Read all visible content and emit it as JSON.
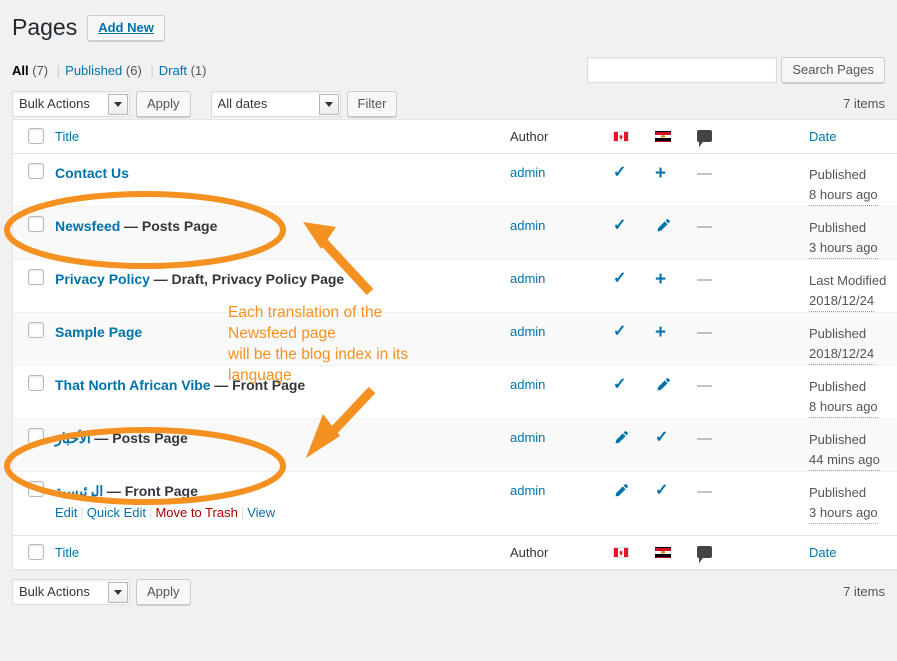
{
  "header": {
    "title": "Pages",
    "add_new_label": "Add New"
  },
  "status_filters": [
    {
      "label": "All",
      "count": "(7)",
      "current": true
    },
    {
      "label": "Published",
      "count": "(6)",
      "current": false
    },
    {
      "label": "Draft",
      "count": "(1)",
      "current": false
    }
  ],
  "search": {
    "value": "",
    "placeholder": "",
    "button_label": "Search Pages"
  },
  "tablenav": {
    "bulk_actions_label": "Bulk Actions",
    "apply_label": "Apply",
    "all_dates_label": "All dates",
    "filter_label": "Filter",
    "items_count_top": "7 items",
    "items_count_bottom": "7 items"
  },
  "columns": {
    "title": "Title",
    "author": "Author",
    "lang_en_icon": "canada-flag-icon",
    "lang_ar_icon": "egypt-flag-icon",
    "comments_icon": "comment-bubble-icon",
    "date": "Date"
  },
  "rows": [
    {
      "title": "Contact Us",
      "state": "",
      "rtl": false,
      "author": "admin",
      "lang_en": "check",
      "lang_ar": "plus",
      "comments": "—",
      "date_status": "Published",
      "date_value": "8 hours ago",
      "actions": []
    },
    {
      "title": "Newsfeed",
      "state": "— Posts Page",
      "rtl": false,
      "author": "admin",
      "lang_en": "check",
      "lang_ar": "pencil",
      "comments": "—",
      "date_status": "Published",
      "date_value": "3 hours ago",
      "actions": []
    },
    {
      "title": "Privacy Policy",
      "state": "— Draft, Privacy Policy Page",
      "rtl": false,
      "author": "admin",
      "lang_en": "check",
      "lang_ar": "plus",
      "comments": "—",
      "date_status": "Last Modified",
      "date_value": "2018/12/24",
      "actions": []
    },
    {
      "title": "Sample Page",
      "state": "",
      "rtl": false,
      "author": "admin",
      "lang_en": "check",
      "lang_ar": "plus",
      "comments": "—",
      "date_status": "Published",
      "date_value": "2018/12/24",
      "actions": []
    },
    {
      "title": "That North African Vibe",
      "state": "— Front Page",
      "rtl": false,
      "author": "admin",
      "lang_en": "check",
      "lang_ar": "pencil",
      "comments": "—",
      "date_status": "Published",
      "date_value": "8 hours ago",
      "actions": []
    },
    {
      "title": "الأخبار",
      "state": "— Posts Page",
      "rtl": true,
      "author": "admin",
      "lang_en": "pencil",
      "lang_ar": "check",
      "comments": "—",
      "date_status": "Published",
      "date_value": "44 mins ago",
      "actions": []
    },
    {
      "title": "الرئيسية",
      "state": "— Front Page",
      "rtl": true,
      "author": "admin",
      "lang_en": "pencil",
      "lang_ar": "check",
      "comments": "—",
      "date_status": "Published",
      "date_value": "3 hours ago",
      "actions": [
        "Edit",
        "Quick Edit",
        "Move to Trash",
        "View"
      ]
    }
  ],
  "annotations": {
    "color": "#f59120",
    "note_lines": [
      "Each translation of the",
      "Newsfeed page",
      "will be the blog index in its",
      "language"
    ],
    "note_text": "Each translation of the\nNewsfeed page\nwill be the blog index in its\nlanguage"
  }
}
